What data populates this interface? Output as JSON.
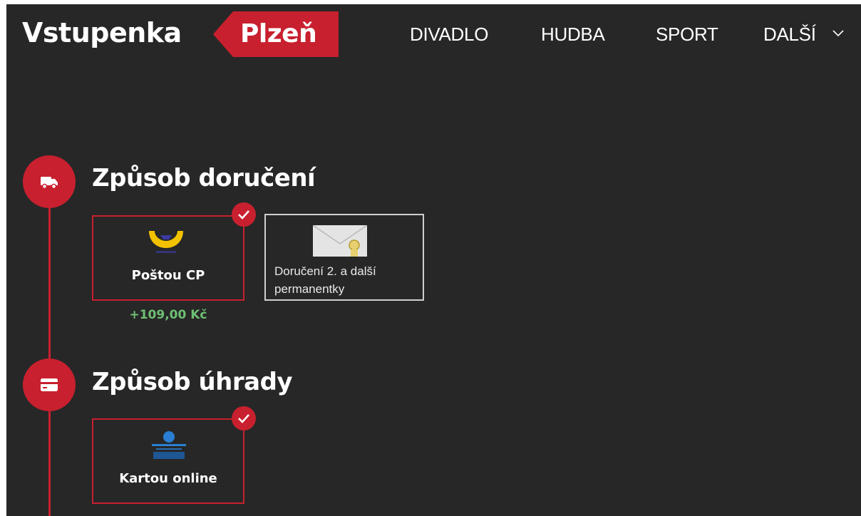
{
  "header": {
    "logo_main": "Vstupenka",
    "logo_city": "Plzeň",
    "nav": [
      {
        "label": "DIVADLO"
      },
      {
        "label": "HUDBA"
      },
      {
        "label": "SPORT"
      },
      {
        "label": "DALŠÍ"
      }
    ]
  },
  "delivery": {
    "title": "Způsob doručení",
    "options": [
      {
        "label": "Poštou CP",
        "price": "+109,00 Kč",
        "selected": true,
        "icon": "posthorn-icon"
      },
      {
        "label": "Doručení 2. a další permanentky",
        "selected": false,
        "icon": "envelope-icon"
      }
    ]
  },
  "payment": {
    "title": "Způsob úhrady",
    "options": [
      {
        "label": "Kartou online",
        "selected": true,
        "icon": "csob-logo"
      }
    ]
  },
  "colors": {
    "accent": "#c8202e",
    "background": "#272727",
    "price": "#6fbf73"
  }
}
